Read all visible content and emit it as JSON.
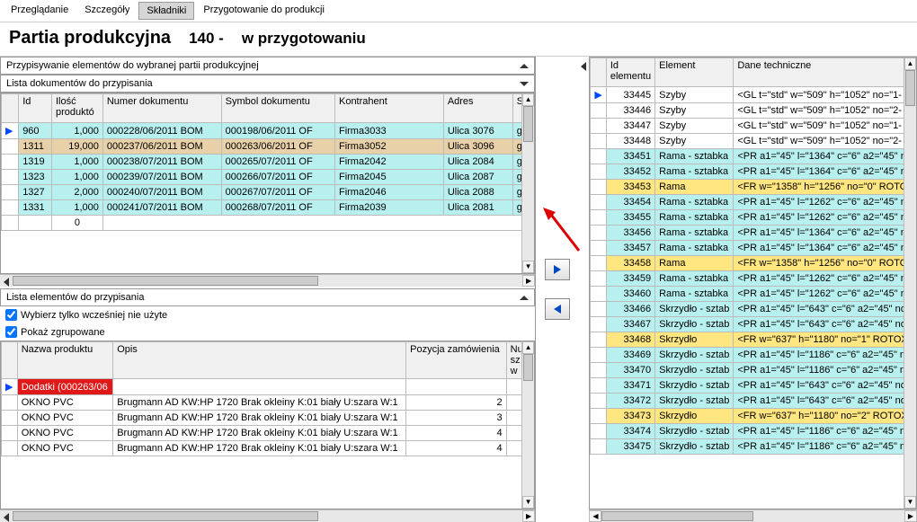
{
  "tabs": [
    "Przeglądanie",
    "Szczegóły",
    "Składniki",
    "Przygotowanie do produkcji"
  ],
  "active_tab": 2,
  "title": {
    "main": "Partia produkcyjna",
    "num": "140 -",
    "status": "w przygotowaniu"
  },
  "left_docs": {
    "panel1": "Przypisywanie elementów do wybranej partii produkcyjnej",
    "panel2": "Lista dokumentów do przypisania",
    "headers": [
      "",
      "Id",
      "Ilość produktó",
      "Numer dokumentu",
      "Symbol dokumentu",
      "Kontrahent",
      "Adres",
      "S"
    ],
    "rows": [
      {
        "sel": "▶",
        "id": "960",
        "qty": "1,000",
        "num": "000228/06/2011 BOM",
        "sym": "000198/06/2011 OF",
        "kontr": "Firma3033",
        "adr": "Ulica 3076",
        "s": "go",
        "cls": "row-cyan"
      },
      {
        "sel": "",
        "id": "1311",
        "qty": "19,000",
        "num": "000237/06/2011 BOM",
        "sym": "000263/06/2011 OF",
        "kontr": "Firma3052",
        "adr": "Ulica 3096",
        "s": "go",
        "cls": "row-beige"
      },
      {
        "sel": "",
        "id": "1319",
        "qty": "1,000",
        "num": "000238/07/2011 BOM",
        "sym": "000265/07/2011 OF",
        "kontr": "Firma2042",
        "adr": "Ulica 2084",
        "s": "go",
        "cls": "row-cyan"
      },
      {
        "sel": "",
        "id": "1323",
        "qty": "1,000",
        "num": "000239/07/2011 BOM",
        "sym": "000266/07/2011 OF",
        "kontr": "Firma2045",
        "adr": "Ulica 2087",
        "s": "go",
        "cls": "row-cyan"
      },
      {
        "sel": "",
        "id": "1327",
        "qty": "2,000",
        "num": "000240/07/2011 BOM",
        "sym": "000267/07/2011 OF",
        "kontr": "Firma2046",
        "adr": "Ulica 2088",
        "s": "go",
        "cls": "row-cyan"
      },
      {
        "sel": "",
        "id": "1331",
        "qty": "1,000",
        "num": "000241/07/2011 BOM",
        "sym": "000268/07/2011 OF",
        "kontr": "Firma2039",
        "adr": "Ulica 2081",
        "s": "go",
        "cls": "row-cyan"
      }
    ],
    "footer_sum": "0"
  },
  "left_elems": {
    "panel": "Lista elementów do przypisania",
    "chk1": "Wybierz tylko wcześniej nie użyte",
    "chk2": "Pokaż zgrupowane",
    "headers": [
      "",
      "Nazwa produktu",
      "Opis",
      "Pozycja zamówienia",
      "Nu sz w"
    ],
    "group_row": "Dodatki (000263/06",
    "rows": [
      {
        "n": "OKNO PVC",
        "o": "Brugmann AD KW:HP 1720 Brak okleiny K:01 biały U:szara W:1",
        "p": "2",
        "nu": ""
      },
      {
        "n": "OKNO PVC",
        "o": "Brugmann AD KW:HP 1720 Brak okleiny K:01 biały U:szara W:1",
        "p": "3",
        "nu": ""
      },
      {
        "n": "OKNO PVC",
        "o": "Brugmann AD KW:HP 1720 Brak okleiny K:01 biały U:szara W:1",
        "p": "4",
        "nu": ""
      },
      {
        "n": "OKNO PVC",
        "o": "Brugmann AD KW:HP 1720 Brak okleiny K:01 biały U:szara W:1",
        "p": "4",
        "nu": ""
      }
    ]
  },
  "right_grid": {
    "headers": [
      "",
      "Id elementu",
      "Element",
      "Dane techniczne"
    ],
    "rows": [
      {
        "sel": "▶",
        "id": "33445",
        "el": "Szyby",
        "dt": "<GL t=\"std\" w=\"509\" h=\"1052\" no=\"1-",
        "cls": "row-white"
      },
      {
        "sel": "",
        "id": "33446",
        "el": "Szyby",
        "dt": "<GL t=\"std\" w=\"509\" h=\"1052\" no=\"2-",
        "cls": "row-white"
      },
      {
        "sel": "",
        "id": "33447",
        "el": "Szyby",
        "dt": "<GL t=\"std\" w=\"509\" h=\"1052\" no=\"1-",
        "cls": "row-white"
      },
      {
        "sel": "",
        "id": "33448",
        "el": "Szyby",
        "dt": "<GL t=\"std\" w=\"509\" h=\"1052\" no=\"2-",
        "cls": "row-white"
      },
      {
        "sel": "",
        "id": "33451",
        "el": "Rama - sztabka",
        "dt": "<PR a1=\"45\" l=\"1364\" c=\"6\" a2=\"45\" no",
        "cls": "row-cyan"
      },
      {
        "sel": "",
        "id": "33452",
        "el": "Rama - sztabka",
        "dt": "<PR a1=\"45\" l=\"1364\" c=\"6\" a2=\"45\" no",
        "cls": "row-cyan"
      },
      {
        "sel": "",
        "id": "33453",
        "el": "Rama",
        "dt": "<FR w=\"1358\" h=\"1256\" no=\"0\" ROTO",
        "cls": "row-yellow"
      },
      {
        "sel": "",
        "id": "33454",
        "el": "Rama - sztabka",
        "dt": "<PR a1=\"45\" l=\"1262\" c=\"6\" a2=\"45\" no",
        "cls": "row-cyan"
      },
      {
        "sel": "",
        "id": "33455",
        "el": "Rama - sztabka",
        "dt": "<PR a1=\"45\" l=\"1262\" c=\"6\" a2=\"45\" no",
        "cls": "row-cyan"
      },
      {
        "sel": "",
        "id": "33456",
        "el": "Rama - sztabka",
        "dt": "<PR a1=\"45\" l=\"1364\" c=\"6\" a2=\"45\" no",
        "cls": "row-cyan"
      },
      {
        "sel": "",
        "id": "33457",
        "el": "Rama - sztabka",
        "dt": "<PR a1=\"45\" l=\"1364\" c=\"6\" a2=\"45\" no",
        "cls": "row-cyan"
      },
      {
        "sel": "",
        "id": "33458",
        "el": "Rama",
        "dt": "<FR w=\"1358\" h=\"1256\" no=\"0\" ROTO",
        "cls": "row-yellow"
      },
      {
        "sel": "",
        "id": "33459",
        "el": "Rama - sztabka",
        "dt": "<PR a1=\"45\" l=\"1262\" c=\"6\" a2=\"45\" no",
        "cls": "row-cyan"
      },
      {
        "sel": "",
        "id": "33460",
        "el": "Rama - sztabka",
        "dt": "<PR a1=\"45\" l=\"1262\" c=\"6\" a2=\"45\" no",
        "cls": "row-cyan"
      },
      {
        "sel": "",
        "id": "33466",
        "el": "Skrzydło - sztab",
        "dt": "<PR a1=\"45\" l=\"643\" c=\"6\" a2=\"45\" no-",
        "cls": "row-cyan"
      },
      {
        "sel": "",
        "id": "33467",
        "el": "Skrzydło - sztab",
        "dt": "<PR a1=\"45\" l=\"643\" c=\"6\" a2=\"45\" no-",
        "cls": "row-cyan"
      },
      {
        "sel": "",
        "id": "33468",
        "el": "Skrzydło",
        "dt": "<FR w=\"637\" h=\"1180\" no=\"1\" ROTOX",
        "cls": "row-yellow"
      },
      {
        "sel": "",
        "id": "33469",
        "el": "Skrzydło - sztab",
        "dt": "<PR a1=\"45\" l=\"1186\" c=\"6\" a2=\"45\" no",
        "cls": "row-cyan"
      },
      {
        "sel": "",
        "id": "33470",
        "el": "Skrzydło - sztab",
        "dt": "<PR a1=\"45\" l=\"1186\" c=\"6\" a2=\"45\" no",
        "cls": "row-cyan"
      },
      {
        "sel": "",
        "id": "33471",
        "el": "Skrzydło - sztab",
        "dt": "<PR a1=\"45\" l=\"643\" c=\"6\" a2=\"45\" no-",
        "cls": "row-cyan"
      },
      {
        "sel": "",
        "id": "33472",
        "el": "Skrzydło - sztab",
        "dt": "<PR a1=\"45\" l=\"643\" c=\"6\" a2=\"45\" no-",
        "cls": "row-cyan"
      },
      {
        "sel": "",
        "id": "33473",
        "el": "Skrzydło",
        "dt": "<FR w=\"637\" h=\"1180\" no=\"2\" ROTOX",
        "cls": "row-yellow"
      },
      {
        "sel": "",
        "id": "33474",
        "el": "Skrzydło - sztab",
        "dt": "<PR a1=\"45\" l=\"1186\" c=\"6\" a2=\"45\" no",
        "cls": "row-cyan"
      },
      {
        "sel": "",
        "id": "33475",
        "el": "Skrzydło - sztab",
        "dt": "<PR a1=\"45\" l=\"1186\" c=\"6\" a2=\"45\" no",
        "cls": "row-cyan"
      }
    ]
  }
}
